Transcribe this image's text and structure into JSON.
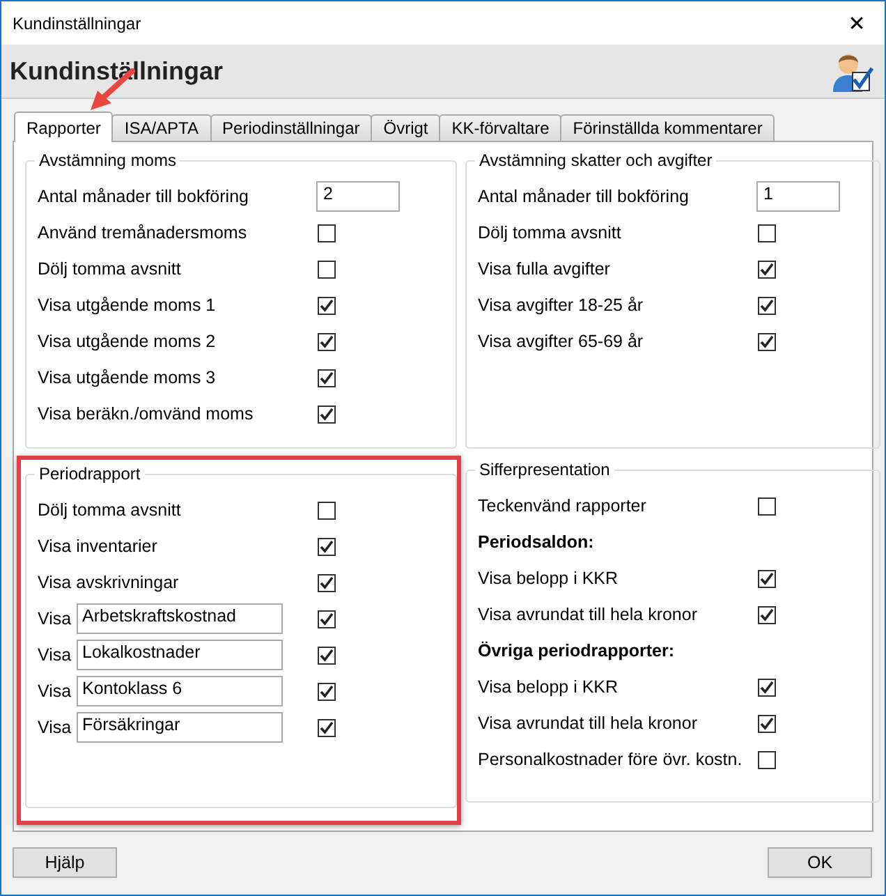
{
  "window": {
    "title": "Kundinställningar",
    "close": "✕"
  },
  "header": {
    "title": "Kundinställningar"
  },
  "tabs": [
    {
      "label": "Rapporter",
      "selected": true,
      "pointed": true
    },
    {
      "label": "ISA/APTA",
      "selected": false,
      "pointed": false
    },
    {
      "label": "Periodinställningar",
      "selected": false,
      "pointed": false
    },
    {
      "label": "Övrigt",
      "selected": false,
      "pointed": false
    },
    {
      "label": "KK-förvaltare",
      "selected": false,
      "pointed": false
    },
    {
      "label": "Förinställda kommentarer",
      "selected": false,
      "pointed": false
    }
  ],
  "groups": [
    {
      "title": "Avstämning moms",
      "highlighted": false,
      "rows": [
        {
          "kind": "field",
          "label": "Antal månader till bokföring",
          "value": "2"
        },
        {
          "kind": "checkbox",
          "label": "Använd tremånadersmoms",
          "checked": false
        },
        {
          "kind": "checkbox",
          "label": "Dölj tomma avsnitt",
          "checked": false
        },
        {
          "kind": "checkbox",
          "label": "Visa utgående moms 1",
          "checked": true
        },
        {
          "kind": "checkbox",
          "label": "Visa utgående moms 2",
          "checked": true
        },
        {
          "kind": "checkbox",
          "label": "Visa utgående moms 3",
          "checked": true
        },
        {
          "kind": "checkbox",
          "label": "Visa beräkn./omvänd moms",
          "checked": true
        }
      ]
    },
    {
      "title": "Avstämning skatter och avgifter",
      "highlighted": false,
      "rows": [
        {
          "kind": "field",
          "label": "Antal månader till bokföring",
          "value": "1"
        },
        {
          "kind": "checkbox",
          "label": "Dölj tomma avsnitt",
          "checked": false
        },
        {
          "kind": "checkbox",
          "label": "Visa fulla avgifter",
          "checked": true
        },
        {
          "kind": "checkbox",
          "label": "Visa avgifter 18-25 år",
          "checked": true
        },
        {
          "kind": "checkbox",
          "label": "Visa avgifter 65-69 år",
          "checked": true
        }
      ]
    },
    {
      "title": "Periodrapport",
      "highlighted": true,
      "rows": [
        {
          "kind": "checkbox",
          "label": "Dölj tomma avsnitt",
          "checked": false
        },
        {
          "kind": "checkbox",
          "label": "Visa inventarier",
          "checked": true
        },
        {
          "kind": "checkbox",
          "label": "Visa avskrivningar",
          "checked": true
        },
        {
          "kind": "named",
          "label": "Visa",
          "value": "Arbetskraftskostnad",
          "checked": true
        },
        {
          "kind": "named",
          "label": "Visa",
          "value": "Lokalkostnader",
          "checked": true
        },
        {
          "kind": "named",
          "label": "Visa",
          "value": "Kontoklass 6",
          "checked": true
        },
        {
          "kind": "named",
          "label": "Visa",
          "value": "Försäkringar",
          "checked": true
        }
      ]
    },
    {
      "title": "Sifferpresentation",
      "highlighted": false,
      "rows": [
        {
          "kind": "checkbox",
          "label": "Teckenvänd rapporter",
          "checked": false
        },
        {
          "kind": "heading",
          "label": "Periodsaldon:"
        },
        {
          "kind": "checkbox",
          "label": "Visa belopp i KKR",
          "checked": true
        },
        {
          "kind": "checkbox",
          "label": "Visa avrundat till hela kronor",
          "checked": true
        },
        {
          "kind": "heading",
          "label": "Övriga periodrapporter:"
        },
        {
          "kind": "checkbox",
          "label": "Visa belopp i KKR",
          "checked": true
        },
        {
          "kind": "checkbox",
          "label": "Visa avrundat till hela kronor",
          "checked": true
        },
        {
          "kind": "checkbox",
          "label": "Personalkostnader före övr. kostn.",
          "checked": false
        }
      ]
    }
  ],
  "buttons": [
    {
      "label": "Hjälp"
    },
    {
      "label": "OK"
    }
  ]
}
